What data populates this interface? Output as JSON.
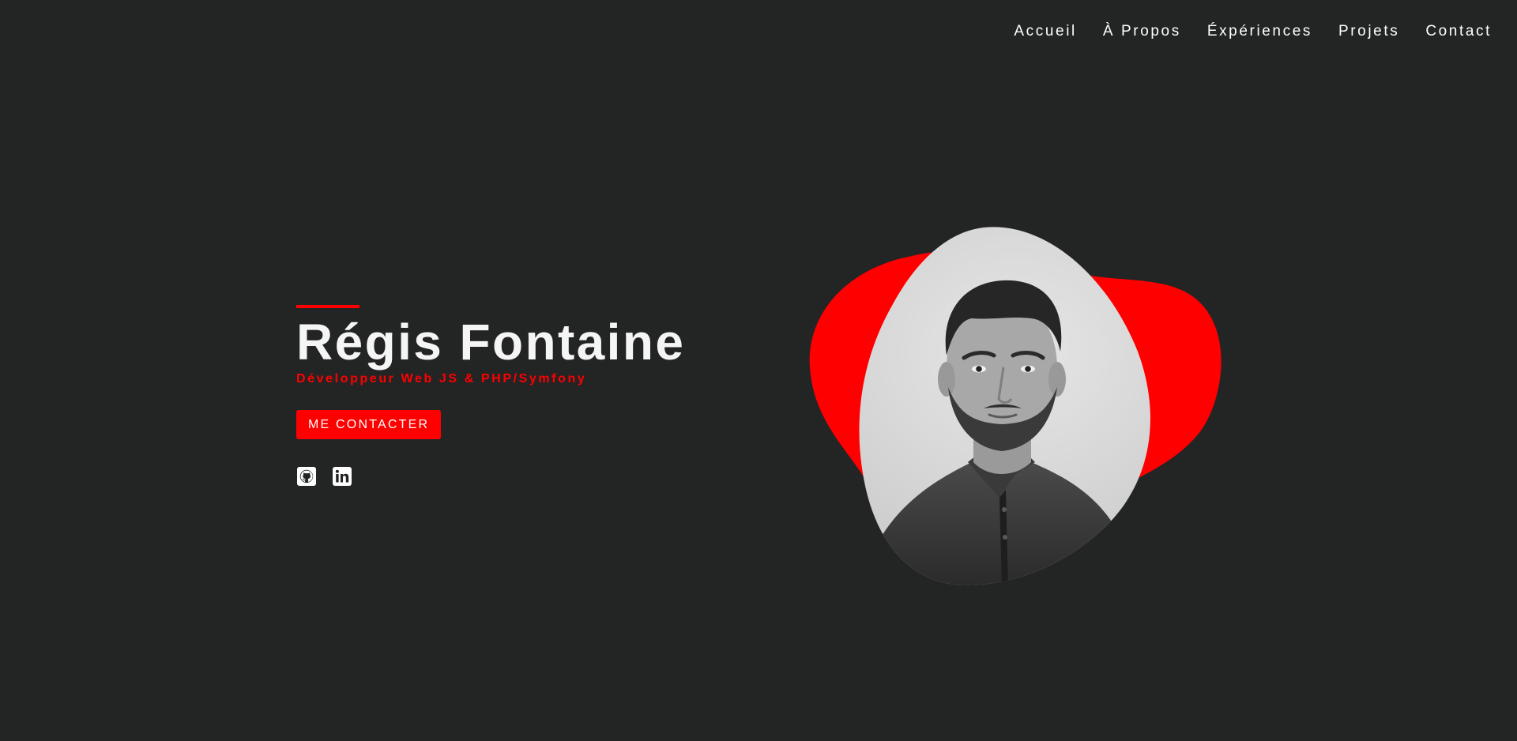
{
  "nav": {
    "items": [
      {
        "label": "Accueil"
      },
      {
        "label": "À Propos"
      },
      {
        "label": "Éxpériences"
      },
      {
        "label": "Projets"
      },
      {
        "label": "Contact"
      }
    ]
  },
  "hero": {
    "name": "Régis Fontaine",
    "subtitle": "Développeur Web JS & PHP/Symfony",
    "cta_label": "ME CONTACTER"
  },
  "socials": {
    "icons": [
      "github-icon",
      "linkedin-icon"
    ]
  },
  "colors": {
    "background": "#232424",
    "accent": "#ff0000",
    "text": "#ffffff"
  }
}
